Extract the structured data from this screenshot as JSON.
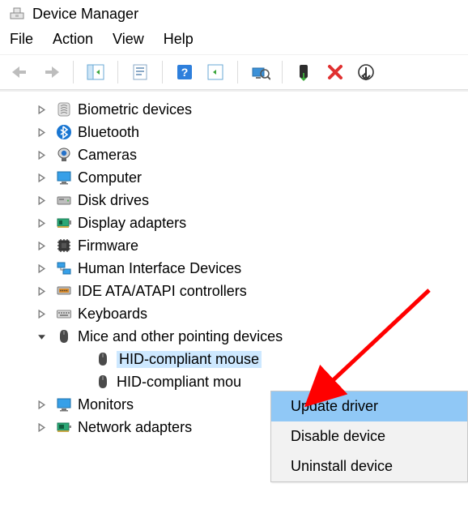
{
  "window": {
    "title": "Device Manager"
  },
  "menu": {
    "items": [
      "File",
      "Action",
      "View",
      "Help"
    ]
  },
  "tree": {
    "nodes": [
      {
        "id": "biometric",
        "label": "Biometric devices",
        "expanded": false,
        "icon": "fingerprint"
      },
      {
        "id": "bluetooth",
        "label": "Bluetooth",
        "expanded": false,
        "icon": "bluetooth"
      },
      {
        "id": "cameras",
        "label": "Cameras",
        "expanded": false,
        "icon": "camera"
      },
      {
        "id": "computer",
        "label": "Computer",
        "expanded": false,
        "icon": "monitor"
      },
      {
        "id": "diskdrives",
        "label": "Disk drives",
        "expanded": false,
        "icon": "disk"
      },
      {
        "id": "display",
        "label": "Display adapters",
        "expanded": false,
        "icon": "displayadapter"
      },
      {
        "id": "firmware",
        "label": "Firmware",
        "expanded": false,
        "icon": "chip"
      },
      {
        "id": "hid",
        "label": "Human Interface Devices",
        "expanded": false,
        "icon": "hid"
      },
      {
        "id": "ide",
        "label": "IDE ATA/ATAPI controllers",
        "expanded": false,
        "icon": "ide"
      },
      {
        "id": "keyboards",
        "label": "Keyboards",
        "expanded": false,
        "icon": "keyboard"
      },
      {
        "id": "mice",
        "label": "Mice and other pointing devices",
        "expanded": true,
        "icon": "mouse",
        "children": [
          {
            "id": "mouse1",
            "label": "HID-compliant mouse",
            "icon": "mouse",
            "selected": true
          },
          {
            "id": "mouse2",
            "label": "HID-compliant mou",
            "icon": "mouse",
            "selected": false
          }
        ]
      },
      {
        "id": "monitors",
        "label": "Monitors",
        "expanded": false,
        "icon": "monitor"
      },
      {
        "id": "network",
        "label": "Network adapters",
        "expanded": false,
        "icon": "network"
      }
    ]
  },
  "context_menu": {
    "items": [
      {
        "label": "Update driver",
        "hover": true
      },
      {
        "label": "Disable device",
        "hover": false
      },
      {
        "label": "Uninstall device",
        "hover": false
      }
    ]
  }
}
